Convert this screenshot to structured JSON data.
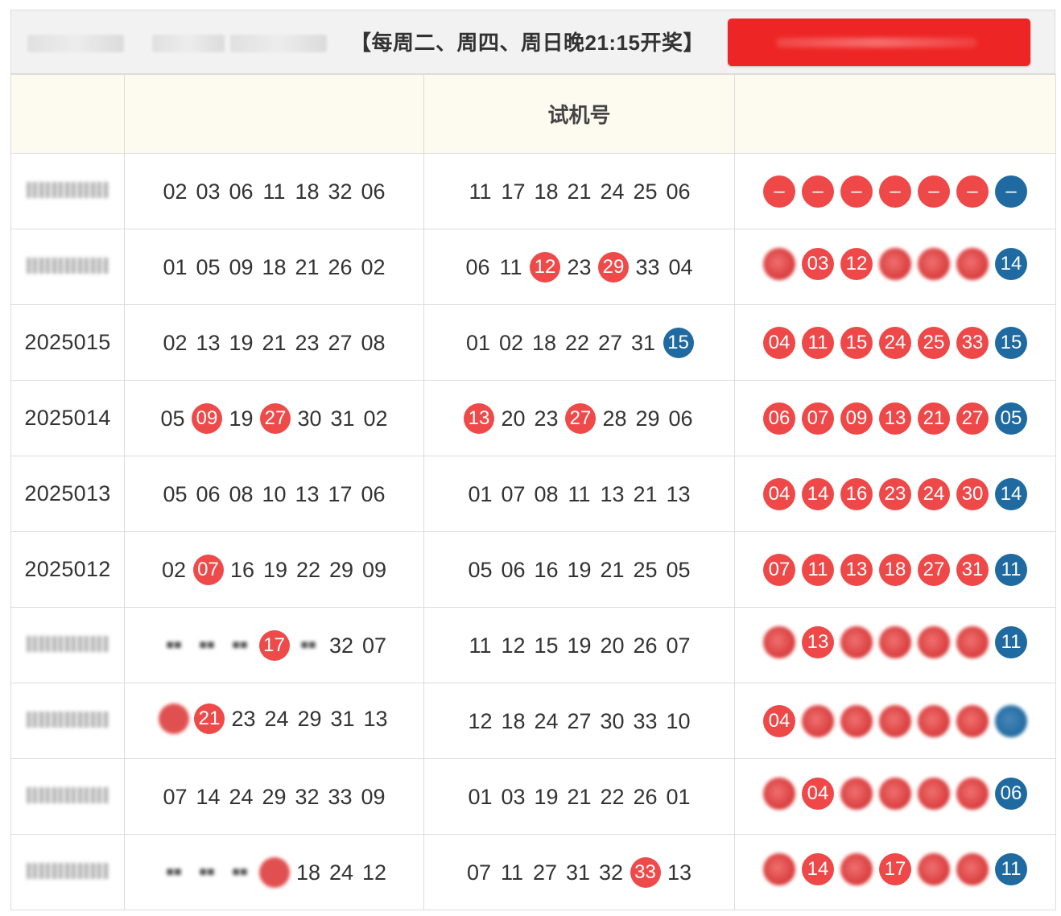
{
  "header": {
    "schedule": "【每周二、周四、周日晚21:15开奖】",
    "colors": {
      "button": "#ee2525",
      "red_ball": "#ee4848",
      "blue_ball": "#1f6aa0",
      "header_row": "#fdfaf0"
    }
  },
  "table": {
    "columns": [
      "",
      "",
      "试机号",
      ""
    ],
    "rows": [
      {
        "issue": "",
        "issue_blurred": true,
        "col1": [
          {
            "v": "02"
          },
          {
            "v": "03"
          },
          {
            "v": "06"
          },
          {
            "v": "11"
          },
          {
            "v": "18"
          },
          {
            "v": "32"
          },
          {
            "v": "06"
          }
        ],
        "col2": [
          {
            "v": "11"
          },
          {
            "v": "17"
          },
          {
            "v": "18"
          },
          {
            "v": "21"
          },
          {
            "v": "24"
          },
          {
            "v": "25"
          },
          {
            "v": "06"
          }
        ],
        "result": [
          {
            "v": "–"
          },
          {
            "v": "–"
          },
          {
            "v": "–"
          },
          {
            "v": "–"
          },
          {
            "v": "–"
          },
          {
            "v": "–"
          },
          {
            "v": "–",
            "blue": true
          }
        ]
      },
      {
        "issue": "",
        "issue_blurred": true,
        "col1": [
          {
            "v": "01"
          },
          {
            "v": "05"
          },
          {
            "v": "09"
          },
          {
            "v": "18"
          },
          {
            "v": "21"
          },
          {
            "v": "26"
          },
          {
            "v": "02"
          }
        ],
        "col2": [
          {
            "v": "06"
          },
          {
            "v": "11"
          },
          {
            "v": "12",
            "hit": true
          },
          {
            "v": "23"
          },
          {
            "v": "29",
            "hit": true
          },
          {
            "v": "33"
          },
          {
            "v": "04"
          }
        ],
        "result": [
          {
            "v": "",
            "blur": true
          },
          {
            "v": "03"
          },
          {
            "v": "12"
          },
          {
            "v": "",
            "blur": true
          },
          {
            "v": "",
            "blur": true
          },
          {
            "v": "",
            "blur": true
          },
          {
            "v": "14",
            "blue": true
          }
        ]
      },
      {
        "issue": "2025015",
        "col1": [
          {
            "v": "02"
          },
          {
            "v": "13"
          },
          {
            "v": "19"
          },
          {
            "v": "21"
          },
          {
            "v": "23"
          },
          {
            "v": "27"
          },
          {
            "v": "08"
          }
        ],
        "col2": [
          {
            "v": "01"
          },
          {
            "v": "02"
          },
          {
            "v": "18"
          },
          {
            "v": "22"
          },
          {
            "v": "27"
          },
          {
            "v": "31"
          },
          {
            "v": "15",
            "blue": true
          }
        ],
        "result": [
          {
            "v": "04"
          },
          {
            "v": "11"
          },
          {
            "v": "15"
          },
          {
            "v": "24"
          },
          {
            "v": "25"
          },
          {
            "v": "33"
          },
          {
            "v": "15",
            "blue": true
          }
        ]
      },
      {
        "issue": "2025014",
        "col1": [
          {
            "v": "05"
          },
          {
            "v": "09",
            "hit": true
          },
          {
            "v": "19"
          },
          {
            "v": "27",
            "hit": true
          },
          {
            "v": "30"
          },
          {
            "v": "31"
          },
          {
            "v": "02"
          }
        ],
        "col2": [
          {
            "v": "13",
            "hit": true
          },
          {
            "v": "20"
          },
          {
            "v": "23"
          },
          {
            "v": "27",
            "hit": true
          },
          {
            "v": "28"
          },
          {
            "v": "29"
          },
          {
            "v": "06"
          }
        ],
        "result": [
          {
            "v": "06"
          },
          {
            "v": "07"
          },
          {
            "v": "09"
          },
          {
            "v": "13"
          },
          {
            "v": "21"
          },
          {
            "v": "27"
          },
          {
            "v": "05",
            "blue": true
          }
        ]
      },
      {
        "issue": "2025013",
        "col1": [
          {
            "v": "05"
          },
          {
            "v": "06"
          },
          {
            "v": "08"
          },
          {
            "v": "10"
          },
          {
            "v": "13"
          },
          {
            "v": "17"
          },
          {
            "v": "06"
          }
        ],
        "col2": [
          {
            "v": "01"
          },
          {
            "v": "07"
          },
          {
            "v": "08"
          },
          {
            "v": "11"
          },
          {
            "v": "13"
          },
          {
            "v": "21"
          },
          {
            "v": "13"
          }
        ],
        "result": [
          {
            "v": "04"
          },
          {
            "v": "14"
          },
          {
            "v": "16"
          },
          {
            "v": "23"
          },
          {
            "v": "24"
          },
          {
            "v": "30"
          },
          {
            "v": "14",
            "blue": true
          }
        ]
      },
      {
        "issue": "2025012",
        "col1": [
          {
            "v": "02"
          },
          {
            "v": "07",
            "hit": true
          },
          {
            "v": "16"
          },
          {
            "v": "19"
          },
          {
            "v": "22"
          },
          {
            "v": "29"
          },
          {
            "v": "09"
          }
        ],
        "col2": [
          {
            "v": "05"
          },
          {
            "v": "06"
          },
          {
            "v": "16"
          },
          {
            "v": "19"
          },
          {
            "v": "21"
          },
          {
            "v": "25"
          },
          {
            "v": "05"
          }
        ],
        "result": [
          {
            "v": "07"
          },
          {
            "v": "11"
          },
          {
            "v": "13"
          },
          {
            "v": "18"
          },
          {
            "v": "27"
          },
          {
            "v": "31"
          },
          {
            "v": "11",
            "blue": true
          }
        ]
      },
      {
        "issue": "",
        "issue_blurred": true,
        "col1": [
          {
            "v": "",
            "blur": true
          },
          {
            "v": "",
            "blur": true
          },
          {
            "v": "",
            "blur": true
          },
          {
            "v": "17",
            "hit": true
          },
          {
            "v": "",
            "blur": true
          },
          {
            "v": "32"
          },
          {
            "v": "07"
          }
        ],
        "col2": [
          {
            "v": "11"
          },
          {
            "v": "12"
          },
          {
            "v": "15"
          },
          {
            "v": "19"
          },
          {
            "v": "20"
          },
          {
            "v": "26"
          },
          {
            "v": "07"
          }
        ],
        "result": [
          {
            "v": "",
            "blur": true
          },
          {
            "v": "13"
          },
          {
            "v": "",
            "blur": true
          },
          {
            "v": "",
            "blur": true
          },
          {
            "v": "",
            "blur": true
          },
          {
            "v": "",
            "blur": true
          },
          {
            "v": "11",
            "blue": true
          }
        ]
      },
      {
        "issue": "",
        "issue_blurred": true,
        "col1": [
          {
            "v": "",
            "hitblur": true
          },
          {
            "v": "21",
            "hit": true
          },
          {
            "v": "23"
          },
          {
            "v": "24"
          },
          {
            "v": "29"
          },
          {
            "v": "31"
          },
          {
            "v": "13"
          }
        ],
        "col2": [
          {
            "v": "12"
          },
          {
            "v": "18"
          },
          {
            "v": "24"
          },
          {
            "v": "27"
          },
          {
            "v": "30"
          },
          {
            "v": "33"
          },
          {
            "v": "10"
          }
        ],
        "result": [
          {
            "v": "04"
          },
          {
            "v": "",
            "blur": true
          },
          {
            "v": "",
            "blur": true
          },
          {
            "v": "",
            "blur": true
          },
          {
            "v": "",
            "blur": true
          },
          {
            "v": "",
            "blur": true
          },
          {
            "v": "",
            "blue": true,
            "blur": true
          }
        ]
      },
      {
        "issue": "",
        "issue_blurred": true,
        "col1": [
          {
            "v": "07"
          },
          {
            "v": "14"
          },
          {
            "v": "24"
          },
          {
            "v": "29"
          },
          {
            "v": "32"
          },
          {
            "v": "33"
          },
          {
            "v": "09"
          }
        ],
        "col2": [
          {
            "v": "01"
          },
          {
            "v": "03"
          },
          {
            "v": "19"
          },
          {
            "v": "21"
          },
          {
            "v": "22"
          },
          {
            "v": "26"
          },
          {
            "v": "01"
          }
        ],
        "result": [
          {
            "v": "",
            "blur": true
          },
          {
            "v": "04"
          },
          {
            "v": "",
            "blur": true
          },
          {
            "v": "",
            "blur": true
          },
          {
            "v": "",
            "blur": true
          },
          {
            "v": "",
            "blur": true
          },
          {
            "v": "06",
            "blue": true
          }
        ]
      },
      {
        "issue": "",
        "issue_blurred": true,
        "col1": [
          {
            "v": "",
            "blur": true
          },
          {
            "v": "",
            "blur": true
          },
          {
            "v": "",
            "blur": true
          },
          {
            "v": "",
            "hitblur": true
          },
          {
            "v": "18"
          },
          {
            "v": "24"
          },
          {
            "v": "12"
          }
        ],
        "col2": [
          {
            "v": "07"
          },
          {
            "v": "11"
          },
          {
            "v": "27"
          },
          {
            "v": "31"
          },
          {
            "v": "32"
          },
          {
            "v": "33",
            "hit": true
          },
          {
            "v": "13"
          }
        ],
        "result": [
          {
            "v": "",
            "blur": true
          },
          {
            "v": "14"
          },
          {
            "v": "",
            "blur": true
          },
          {
            "v": "17"
          },
          {
            "v": "",
            "blur": true
          },
          {
            "v": "",
            "blur": true
          },
          {
            "v": "11",
            "blue": true
          }
        ]
      }
    ]
  }
}
